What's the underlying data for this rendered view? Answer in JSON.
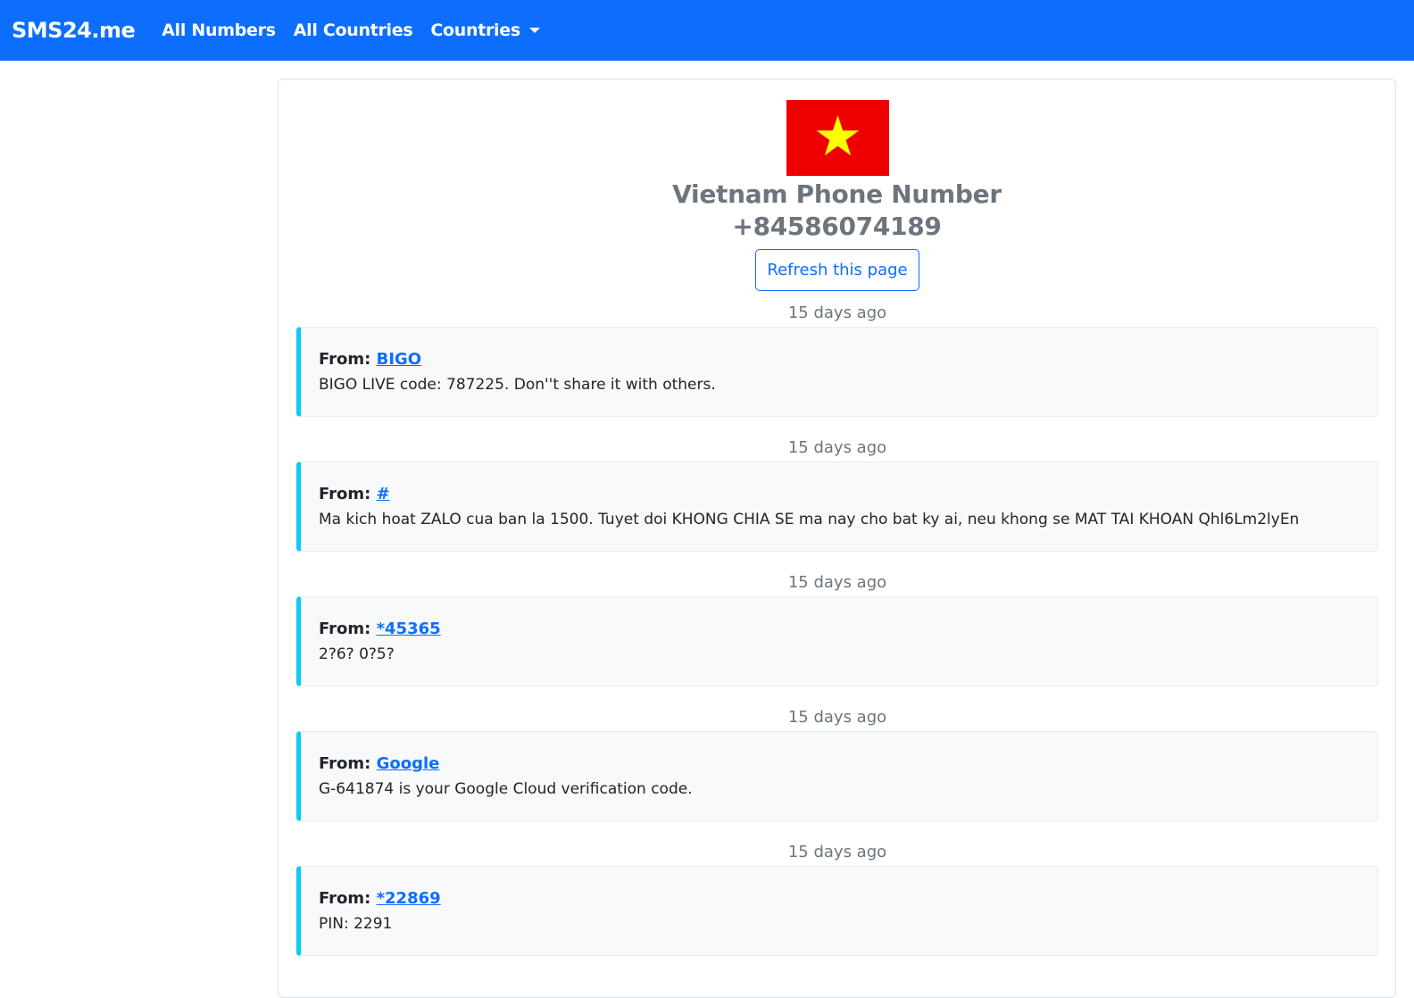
{
  "nav": {
    "brand": "SMS24.me",
    "links": [
      "All Numbers",
      "All Countries",
      "Countries"
    ]
  },
  "header": {
    "country_line": "Vietnam Phone Number",
    "number_line": "+84586074189",
    "refresh_label": "Refresh this page",
    "flag_colors": {
      "field": "#EE0000",
      "star": "#FFFF00"
    }
  },
  "messages": [
    {
      "time": "15 days ago",
      "from_label": "From:",
      "sender": "BIGO",
      "text": "BIGO LIVE code: 787225. Don''t share it with others."
    },
    {
      "time": "15 days ago",
      "from_label": "From:",
      "sender": "#",
      "text": "Ma kich hoat ZALO cua ban la 1500. Tuyet doi KHONG CHIA SE ma nay cho bat ky ai, neu khong se MAT TAI KHOAN Qhl6Lm2lyEn"
    },
    {
      "time": "15 days ago",
      "from_label": "From:",
      "sender": "*45365",
      "text": "2?6? 0?5?"
    },
    {
      "time": "15 days ago",
      "from_label": "From:",
      "sender": "Google",
      "text": "G-641874 is your Google Cloud verification code."
    },
    {
      "time": "15 days ago",
      "from_label": "From:",
      "sender": "*22869",
      "text": "PIN: 2291"
    }
  ]
}
